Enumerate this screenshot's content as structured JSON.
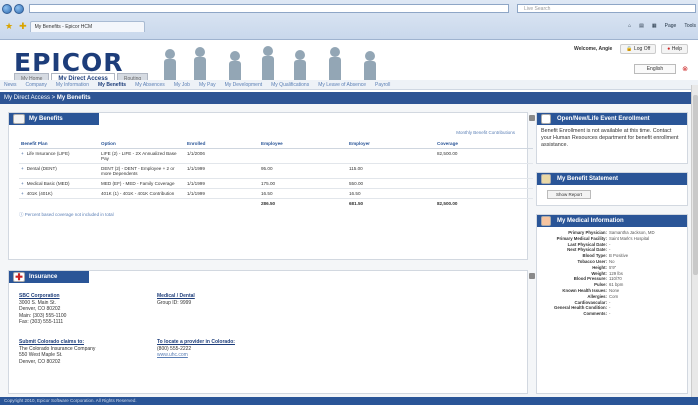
{
  "browser": {
    "tab_title": "My Benefits - Epicor HCM",
    "search_placeholder": "Live Search",
    "toolbar_page": "Page",
    "toolbar_tools": "Tools"
  },
  "header": {
    "logo": "EPICOR",
    "welcome": "Welcome, Angie",
    "logoff": "Log Off",
    "help": "Help",
    "language": "English",
    "app_tabs": [
      "My Home",
      "My Direct Access",
      "Routing"
    ]
  },
  "subnav": [
    "News",
    "Company",
    "My Information",
    "My Benefits",
    "My Absences",
    "My Job",
    "My Pay",
    "My Development",
    "My Qualifications",
    "My Leave of Absence",
    "Payroll"
  ],
  "breadcrumb": {
    "root": "My Direct Access",
    "sep": " > ",
    "current": "My Benefits"
  },
  "benefits": {
    "title": "My Benefits",
    "summary_link": "Monthly Benefit Contributions",
    "columns": [
      "Benefit Plan",
      "Option",
      "Enrolled",
      "Employee",
      "Employer",
      "Coverage"
    ],
    "rows": [
      {
        "plan": "Life Insurance (LIFE)",
        "option": "LIFE (2) - LIFE - 2X Annualized Base Pay",
        "enrolled": "1/1/2006",
        "employee": "",
        "employer": "",
        "coverage": "82,500.00"
      },
      {
        "plan": "Dental (DENT)",
        "option": "DENT (2) - DENT - Employee + 2 or more Dependents",
        "enrolled": "1/1/1999",
        "employee": "95.00",
        "employer": "115.00",
        "coverage": ""
      },
      {
        "plan": "Medical Basic (MED)",
        "option": "MED (EF) - MED - Family Coverage",
        "enrolled": "1/1/1999",
        "employee": "175.00",
        "employer": "550.00",
        "coverage": ""
      },
      {
        "plan": "401K (401K)",
        "option": "401K (1) - 401K - 401K Contribution",
        "enrolled": "1/1/1999",
        "employee": "16.50",
        "employer": "16.50",
        "coverage": ""
      }
    ],
    "totals": {
      "employee": "286.50",
      "employer": "681.50",
      "coverage": "82,500.00"
    },
    "note": "Percent based coverage not included in total"
  },
  "insurance": {
    "title": "Insurance",
    "company_name": "SBC Corporation",
    "company_lines": [
      "3000 S. Main St.",
      "Denver, CO 80202",
      "Main: (303) 555-1100",
      "Fax: (303) 555-1111"
    ],
    "medical_title": "Medical / Dental",
    "medical_lines": [
      "Group ID: 9999"
    ],
    "claims_title": "Submit Colorado claims to:",
    "claims_lines": [
      "The Colorado Insurance Company",
      "550 West Maple St.",
      "Denver, CO 80202"
    ],
    "provider_title": "To locate a provider in Colorado:",
    "provider_lines": [
      "(800) 555-2222"
    ],
    "provider_link": "www.uhc.com"
  },
  "life_event": {
    "title": "Open/New/Life Event Enrollment",
    "text": "Benefit Enrollment is not available at this time. Contact your Human Resources department for benefit enrollment assistance."
  },
  "statement": {
    "title": "My Benefit Statement",
    "button": "Show Report"
  },
  "medical_info": {
    "title": "My Medical Information",
    "rows": [
      {
        "k": "Primary Physician:",
        "v": "Samantha Jackson, MD"
      },
      {
        "k": "Primary Medical Facility:",
        "v": "Saint Mark's Hospital"
      },
      {
        "k": "Last Physical Date:",
        "v": "-"
      },
      {
        "k": "Next Physical Date:",
        "v": "-"
      },
      {
        "k": "Blood Type:",
        "v": "B Positive"
      },
      {
        "k": "Tobacco User:",
        "v": "No"
      },
      {
        "k": "Height:",
        "v": "5'9\""
      },
      {
        "k": "Weight:",
        "v": "129 lbs"
      },
      {
        "k": "Blood Pressure:",
        "v": "110/70"
      },
      {
        "k": "Pulse:",
        "v": "61 bpm"
      },
      {
        "k": "Known Health Issues:",
        "v": "None"
      },
      {
        "k": "Allergies:",
        "v": "Corn"
      },
      {
        "k": "Cardiovascular:",
        "v": "-"
      },
      {
        "k": "General Health Condition:",
        "v": "-"
      },
      {
        "k": "Comments:",
        "v": "-"
      }
    ]
  },
  "footer": "Copyright 2010, Epicor Software Corporation. All Rights Reserved.",
  "colors": {
    "brand_blue": "#2a5597",
    "logo_navy": "#1d3d7a",
    "link_blue": "#5b7fb5"
  }
}
